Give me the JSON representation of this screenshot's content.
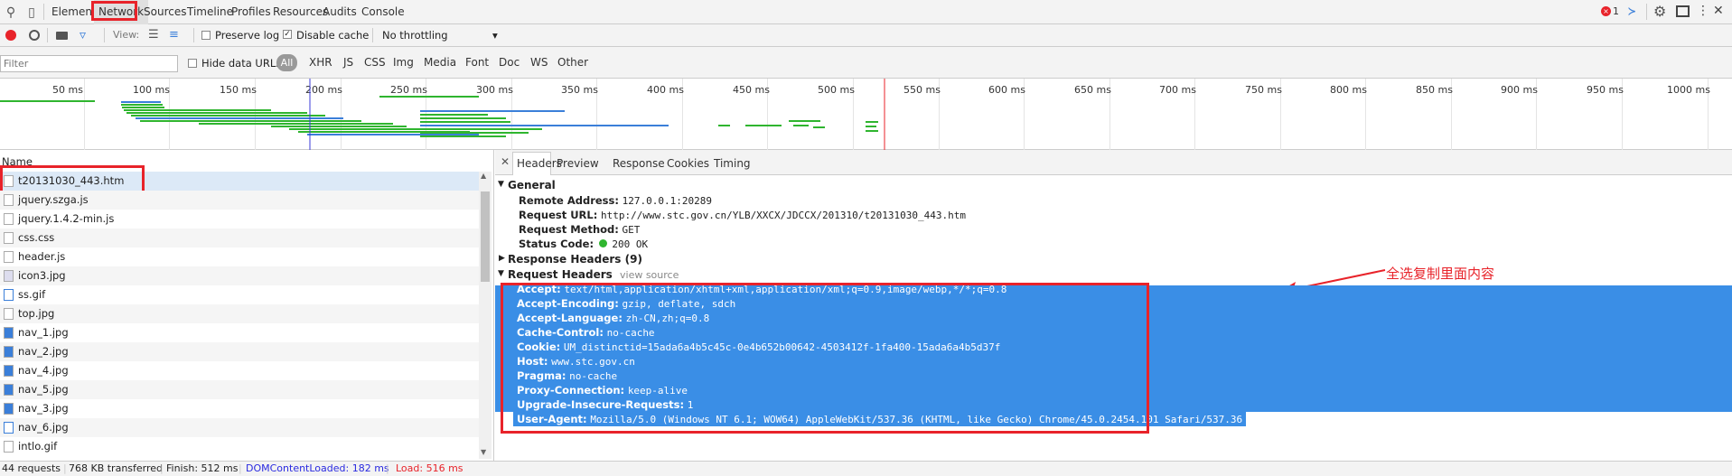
{
  "topbar": {
    "tabs": [
      {
        "label": "Elements"
      },
      {
        "label": "Network"
      },
      {
        "label": "Sources"
      },
      {
        "label": "Timeline"
      },
      {
        "label": "Profiles"
      },
      {
        "label": "Resources"
      },
      {
        "label": "Audits"
      },
      {
        "label": "Console"
      }
    ],
    "error_count": "1"
  },
  "toolbar": {
    "view_label": "View:",
    "preserve_log": "Preserve log",
    "disable_cache": "Disable cache",
    "throttling": "No throttling"
  },
  "filterbar": {
    "placeholder": "Filter",
    "hide_data_urls": "Hide data URLs",
    "types": [
      "All",
      "XHR",
      "JS",
      "CSS",
      "Img",
      "Media",
      "Font",
      "Doc",
      "WS",
      "Other"
    ]
  },
  "timeline": {
    "ticks": [
      "50 ms",
      "100 ms",
      "150 ms",
      "200 ms",
      "250 ms",
      "300 ms",
      "350 ms",
      "400 ms",
      "450 ms",
      "500 ms",
      "550 ms",
      "600 ms",
      "650 ms",
      "700 ms",
      "750 ms",
      "800 ms",
      "850 ms",
      "900 ms",
      "950 ms",
      "1000 ms"
    ]
  },
  "requests": {
    "header": "Name",
    "items": [
      "t20131030_443.htm",
      "jquery.szga.js",
      "jquery.1.4.2-min.js",
      "css.css",
      "header.js",
      "icon3.jpg",
      "ss.gif",
      "top.jpg",
      "nav_1.jpg",
      "nav_2.jpg",
      "nav_4.jpg",
      "nav_5.jpg",
      "nav_3.jpg",
      "nav_6.jpg",
      "intlo.gif"
    ]
  },
  "statusbar": {
    "requests": "44 requests",
    "transferred": "768 KB transferred",
    "finish": "Finish: 512 ms",
    "dom": "DOMContentLoaded: 182 ms",
    "load": "Load: 516 ms"
  },
  "details": {
    "tabs": [
      "Headers",
      "Preview",
      "Response",
      "Cookies",
      "Timing"
    ],
    "general_title": "General",
    "general": [
      {
        "key": "Remote Address:",
        "value": "127.0.0.1:20289"
      },
      {
        "key": "Request URL:",
        "value": "http://www.stc.gov.cn/YLB/XXCX/JDCCX/201310/t20131030_443.htm"
      },
      {
        "key": "Request Method:",
        "value": "GET"
      },
      {
        "key": "Status Code:",
        "value": "200 OK"
      }
    ],
    "response_headers_title": "Response Headers (9)",
    "request_headers_title": "Request Headers",
    "view_source": "view source",
    "annotation": "全选复制里面内容",
    "request_headers": [
      {
        "key": "Accept:",
        "value": "text/html,application/xhtml+xml,application/xml;q=0.9,image/webp,*/*;q=0.8"
      },
      {
        "key": "Accept-Encoding:",
        "value": "gzip, deflate, sdch"
      },
      {
        "key": "Accept-Language:",
        "value": "zh-CN,zh;q=0.8"
      },
      {
        "key": "Cache-Control:",
        "value": "no-cache"
      },
      {
        "key": "Cookie:",
        "value": "UM_distinctid=15ada6a4b5c45c-0e4b652b00642-4503412f-1fa400-15ada6a4b5d37f"
      },
      {
        "key": "Host:",
        "value": "www.stc.gov.cn"
      },
      {
        "key": "Pragma:",
        "value": "no-cache"
      },
      {
        "key": "Proxy-Connection:",
        "value": "keep-alive"
      },
      {
        "key": "Upgrade-Insecure-Requests:",
        "value": "1"
      },
      {
        "key": "User-Agent:",
        "value": "Mozilla/5.0 (Windows NT 6.1; WOW64) AppleWebKit/537.36 (KHTML, like Gecko) Chrome/45.0.2454.101 Safari/537.36"
      }
    ]
  },
  "colors": {
    "accent": "#3a8ee6",
    "highlight_box": "#e8232a",
    "bar_green": "#2fb52f",
    "bar_blue": "#3b7fd9"
  }
}
